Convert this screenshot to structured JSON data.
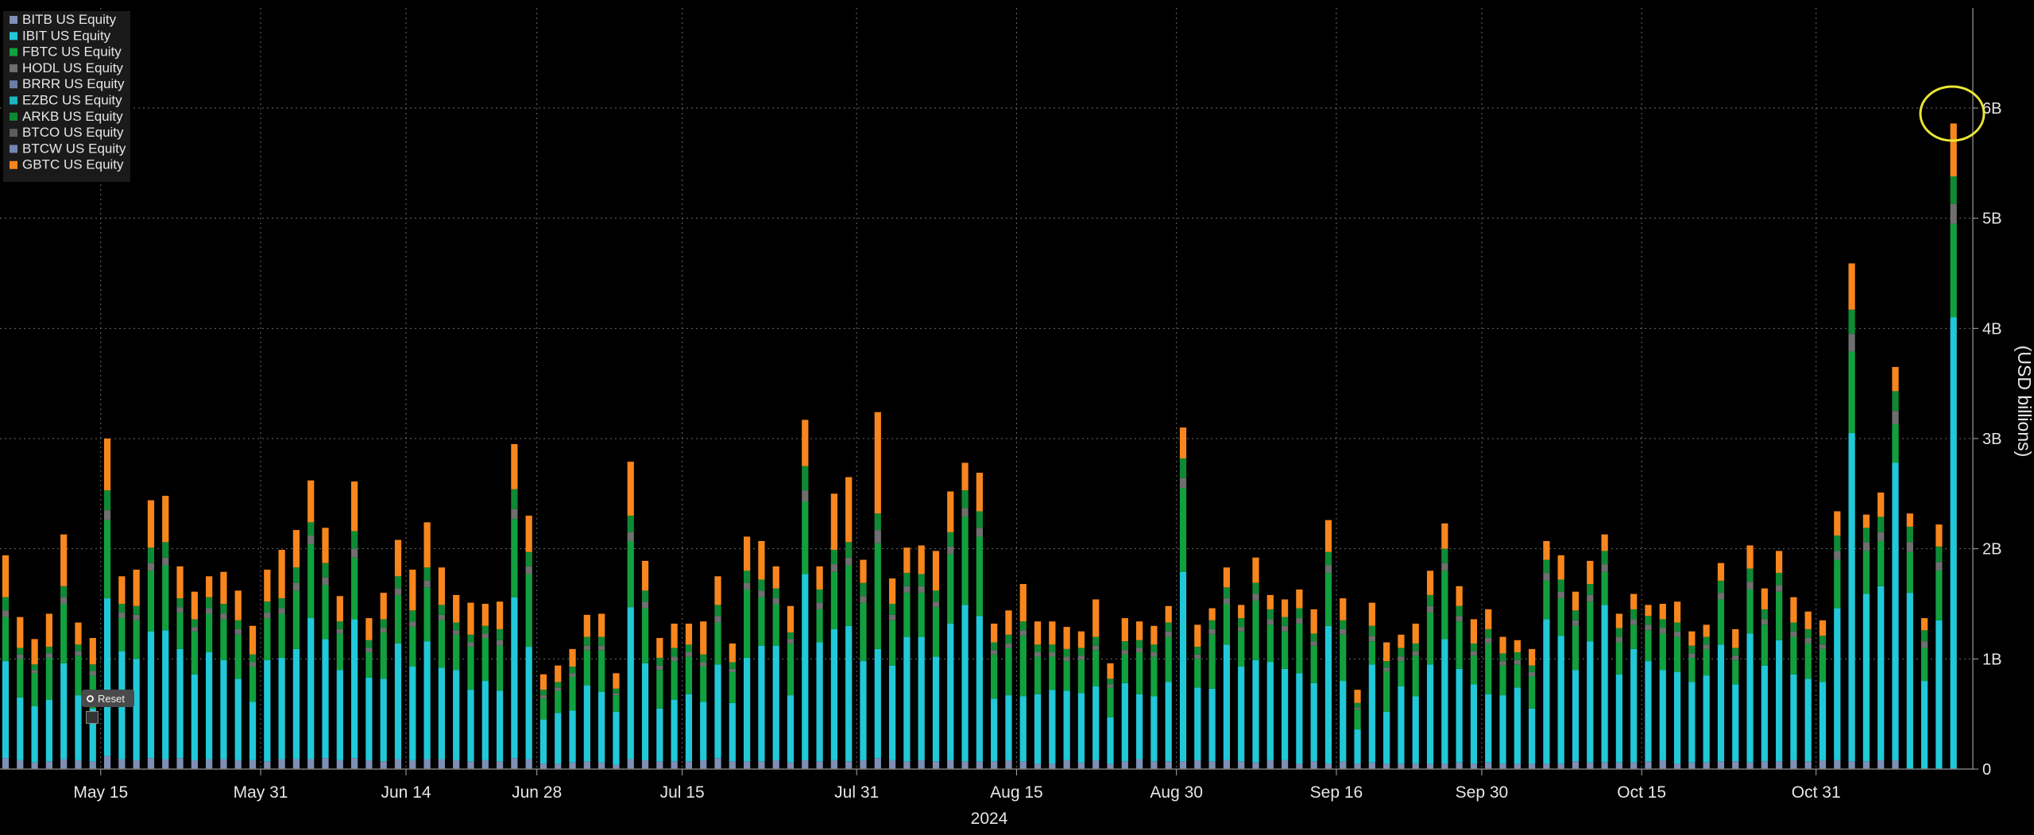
{
  "chart_data": {
    "type": "bar",
    "stacked": true,
    "ylabel": "(USD billions)",
    "xlabel_year": "2024",
    "ylim": [
      0,
      7
    ],
    "y_ticks": [
      {
        "value": 0,
        "label": "0"
      },
      {
        "value": 1,
        "label": "1B"
      },
      {
        "value": 2,
        "label": "2B"
      },
      {
        "value": 3,
        "label": "3B"
      },
      {
        "value": 4,
        "label": "4B"
      },
      {
        "value": 5,
        "label": "5B"
      },
      {
        "value": 6,
        "label": "6B"
      }
    ],
    "x_ticks": [
      {
        "index": 6,
        "label": "May 15"
      },
      {
        "index": 17,
        "label": "May 31"
      },
      {
        "index": 27,
        "label": "Jun 14"
      },
      {
        "index": 36,
        "label": "Jun 28"
      },
      {
        "index": 46,
        "label": "Jul 15"
      },
      {
        "index": 58,
        "label": "Jul 31"
      },
      {
        "index": 69,
        "label": "Aug 15"
      },
      {
        "index": 80,
        "label": "Aug 30"
      },
      {
        "index": 91,
        "label": "Sep 16"
      },
      {
        "index": 101,
        "label": "Sep 30"
      },
      {
        "index": 112,
        "label": "Oct 15"
      },
      {
        "index": 124,
        "label": "Oct 31"
      }
    ],
    "legend_position": "top-left",
    "series_order_bottom_to_top": [
      "BITB US Equity",
      "IBIT US Equity",
      "FBTC US Equity",
      "HODL US Equity",
      "BRRR US Equity",
      "EZBC US Equity",
      "ARKB US Equity",
      "BTCO US Equity",
      "BTCW US Equity",
      "GBTC US Equity"
    ],
    "legend": [
      {
        "name": "BITB US Equity",
        "color": "#7f8fb5"
      },
      {
        "name": "IBIT US Equity",
        "color": "#21c8d8"
      },
      {
        "name": "FBTC US Equity",
        "color": "#12a03e"
      },
      {
        "name": "HODL US Equity",
        "color": "#6f6f6f"
      },
      {
        "name": "BRRR US Equity",
        "color": "#6a7fa8"
      },
      {
        "name": "EZBC US Equity",
        "color": "#1bb5c4"
      },
      {
        "name": "ARKB US Equity",
        "color": "#0f8a34"
      },
      {
        "name": "BTCO US Equity",
        "color": "#5c5c5c"
      },
      {
        "name": "BTCW US Equity",
        "color": "#7088b0"
      },
      {
        "name": "GBTC US Equity",
        "color": "#f7861e"
      }
    ],
    "series_values": {
      "BITB": [
        0.1,
        0.08,
        0.06,
        0.07,
        0.09,
        0.08,
        0.07,
        0.12,
        0.09,
        0.08,
        0.1,
        0.09,
        0.1,
        0.08,
        0.09,
        0.09,
        0.08,
        0.08,
        0.07,
        0.09,
        0.09,
        0.09,
        0.1,
        0.08,
        0.1,
        0.08,
        0.07,
        0.09,
        0.08,
        0.09,
        0.09,
        0.08,
        0.07,
        0.08,
        0.07,
        0.1,
        0.09,
        0.05,
        0.05,
        0.06,
        0.07,
        0.06,
        0.04,
        0.09,
        0.08,
        0.07,
        0.07,
        0.07,
        0.08,
        0.1,
        0.07,
        0.07,
        0.07,
        0.08,
        0.06,
        0.08,
        0.07,
        0.08,
        0.07,
        0.08,
        0.1,
        0.08,
        0.07,
        0.08,
        0.07,
        0.08,
        0.07,
        0.07,
        0.07,
        0.08,
        0.07,
        0.05,
        0.05,
        0.08,
        0.06,
        0.08,
        0.05,
        0.07,
        0.09,
        0.07,
        0.07,
        0.07,
        0.08,
        0.07,
        0.08,
        0.07,
        0.06,
        0.08,
        0.08,
        0.05,
        0.07,
        0.05,
        0.07,
        0.05,
        0.06,
        0.05,
        0.05,
        0.05,
        0.05,
        0.05,
        0.06,
        0.05,
        0.06,
        0.05,
        0.05,
        0.05,
        0.05,
        0.05,
        0.07,
        0.06,
        0.06,
        0.06,
        0.06,
        0.07,
        0.08,
        0.05,
        0.06,
        0.06,
        0.07,
        0.07,
        0.06,
        0.07,
        0.07,
        0.08,
        0.07,
        0.08,
        0.08,
        0.07,
        0.07,
        0.08,
        0.08
      ],
      "IBIT": [
        0.88,
        0.57,
        0.51,
        0.56,
        0.87,
        0.59,
        0.48,
        1.43,
        0.98,
        0.92,
        1.15,
        1.17,
        0.99,
        0.78,
        0.97,
        0.9,
        0.74,
        0.53,
        0.92,
        0.92,
        1.0,
        1.28,
        1.08,
        0.82,
        1.26,
        0.75,
        0.75,
        1.05,
        0.85,
        1.07,
        0.83,
        0.82,
        0.65,
        0.72,
        0.64,
        1.46,
        1.02,
        0.4,
        0.46,
        0.47,
        0.69,
        0.64,
        0.48,
        1.38,
        0.88,
        0.48,
        0.56,
        0.61,
        0.53,
        0.85,
        0.53,
        0.94,
        1.05,
        1.04,
        0.61,
        1.69,
        1.08,
        1.19,
        1.23,
        0.9,
        0.99,
        0.86,
        1.13,
        1.12,
        0.95,
        1.24,
        1.42,
        1.32,
        0.57,
        0.59,
        0.59,
        0.63,
        0.67,
        0.63,
        0.63,
        0.67,
        0.42,
        0.71,
        0.59,
        0.59,
        0.72,
        1.72,
        0.66,
        0.66,
        1.05,
        0.86,
        0.93,
        0.89,
        0.83,
        0.82,
        0.71,
        1.25,
        0.73,
        0.31,
        0.89,
        0.47,
        0.7,
        0.61,
        0.9,
        1.13,
        0.85,
        0.72,
        0.62,
        0.62,
        0.69,
        0.5,
        1.31,
        1.16,
        0.83,
        1.1,
        1.43,
        0.8,
        1.03,
        0.91,
        0.82,
        0.83,
        0.73,
        0.79,
        1.06,
        0.7,
        1.17,
        0.87,
        1.1,
        0.78,
        0.75,
        0.71,
        1.38,
        2.98,
        1.52,
        1.58,
        2.7,
        1.6,
        0.8,
        1.35,
        4.1
      ],
      "FBTC": [
        0.4,
        0.35,
        0.3,
        0.38,
        0.54,
        0.36,
        0.3,
        0.71,
        0.3,
        0.35,
        0.55,
        0.59,
        0.33,
        0.39,
        0.35,
        0.37,
        0.4,
        0.32,
        0.38,
        0.4,
        0.53,
        0.67,
        0.49,
        0.33,
        0.56,
        0.23,
        0.42,
        0.44,
        0.36,
        0.49,
        0.43,
        0.32,
        0.39,
        0.39,
        0.41,
        0.71,
        0.66,
        0.19,
        0.2,
        0.31,
        0.32,
        0.38,
        0.15,
        0.6,
        0.5,
        0.35,
        0.35,
        0.34,
        0.32,
        0.38,
        0.28,
        0.62,
        0.44,
        0.38,
        0.47,
        0.66,
        0.3,
        0.52,
        0.55,
        0.53,
        0.96,
        0.41,
        0.4,
        0.4,
        0.45,
        0.63,
        0.8,
        0.72,
        0.4,
        0.43,
        0.55,
        0.34,
        0.3,
        0.27,
        0.3,
        0.33,
        0.27,
        0.26,
        0.38,
        0.36,
        0.41,
        0.76,
        0.26,
        0.49,
        0.37,
        0.32,
        0.54,
        0.34,
        0.34,
        0.45,
        0.34,
        0.48,
        0.42,
        0.18,
        0.21,
        0.37,
        0.23,
        0.37,
        0.47,
        0.62,
        0.43,
        0.26,
        0.46,
        0.27,
        0.21,
        0.29,
        0.35,
        0.34,
        0.4,
        0.36,
        0.3,
        0.29,
        0.22,
        0.28,
        0.33,
        0.32,
        0.22,
        0.24,
        0.41,
        0.22,
        0.4,
        0.37,
        0.44,
        0.34,
        0.32,
        0.3,
        0.44,
        0.74,
        0.39,
        0.41,
        0.35,
        0.37,
        0.3,
        0.45,
        0.85
      ],
      "ARKB": [
        0.12,
        0.06,
        0.05,
        0.06,
        0.1,
        0.06,
        0.06,
        0.18,
        0.08,
        0.08,
        0.14,
        0.14,
        0.08,
        0.07,
        0.1,
        0.09,
        0.08,
        0.07,
        0.1,
        0.09,
        0.14,
        0.12,
        0.13,
        0.07,
        0.16,
        0.07,
        0.08,
        0.11,
        0.1,
        0.12,
        0.09,
        0.07,
        0.07,
        0.07,
        0.1,
        0.18,
        0.13,
        0.05,
        0.05,
        0.06,
        0.08,
        0.08,
        0.04,
        0.15,
        0.1,
        0.07,
        0.08,
        0.07,
        0.07,
        0.1,
        0.06,
        0.11,
        0.1,
        0.09,
        0.06,
        0.22,
        0.12,
        0.13,
        0.14,
        0.12,
        0.15,
        0.1,
        0.12,
        0.11,
        0.1,
        0.13,
        0.16,
        0.15,
        0.07,
        0.08,
        0.08,
        0.07,
        0.07,
        0.07,
        0.07,
        0.08,
        0.05,
        0.08,
        0.07,
        0.07,
        0.08,
        0.18,
        0.07,
        0.08,
        0.1,
        0.08,
        0.1,
        0.09,
        0.08,
        0.09,
        0.07,
        0.12,
        0.08,
        0.04,
        0.09,
        0.06,
        0.08,
        0.07,
        0.1,
        0.13,
        0.09,
        0.07,
        0.08,
        0.07,
        0.07,
        0.06,
        0.12,
        0.11,
        0.09,
        0.1,
        0.12,
        0.08,
        0.09,
        0.08,
        0.08,
        0.08,
        0.07,
        0.07,
        0.11,
        0.07,
        0.12,
        0.09,
        0.11,
        0.08,
        0.08,
        0.08,
        0.14,
        0.22,
        0.13,
        0.14,
        0.18,
        0.14,
        0.1,
        0.14,
        0.25
      ],
      "Other": [
        0.06,
        0.04,
        0.03,
        0.04,
        0.06,
        0.04,
        0.04,
        0.09,
        0.05,
        0.05,
        0.07,
        0.07,
        0.05,
        0.04,
        0.05,
        0.05,
        0.05,
        0.04,
        0.05,
        0.05,
        0.07,
        0.08,
        0.07,
        0.04,
        0.08,
        0.04,
        0.04,
        0.06,
        0.05,
        0.06,
        0.05,
        0.04,
        0.04,
        0.04,
        0.05,
        0.09,
        0.07,
        0.03,
        0.03,
        0.03,
        0.04,
        0.04,
        0.02,
        0.08,
        0.06,
        0.04,
        0.04,
        0.04,
        0.04,
        0.06,
        0.03,
        0.06,
        0.06,
        0.05,
        0.04,
        0.1,
        0.06,
        0.07,
        0.07,
        0.06,
        0.12,
        0.05,
        0.06,
        0.06,
        0.05,
        0.07,
        0.08,
        0.08,
        0.04,
        0.04,
        0.05,
        0.04,
        0.04,
        0.04,
        0.04,
        0.04,
        0.03,
        0.04,
        0.04,
        0.04,
        0.05,
        0.09,
        0.04,
        0.05,
        0.05,
        0.04,
        0.06,
        0.05,
        0.05,
        0.05,
        0.04,
        0.07,
        0.05,
        0.02,
        0.05,
        0.03,
        0.04,
        0.04,
        0.06,
        0.07,
        0.05,
        0.04,
        0.05,
        0.04,
        0.04,
        0.04,
        0.07,
        0.06,
        0.05,
        0.06,
        0.07,
        0.05,
        0.05,
        0.05,
        0.05,
        0.05,
        0.04,
        0.04,
        0.06,
        0.04,
        0.07,
        0.05,
        0.06,
        0.05,
        0.05,
        0.04,
        0.08,
        0.16,
        0.08,
        0.08,
        0.12,
        0.09,
        0.06,
        0.08,
        0.18
      ],
      "GBTC": [
        0.38,
        0.28,
        0.23,
        0.3,
        0.47,
        0.2,
        0.24,
        0.47,
        0.25,
        0.33,
        0.43,
        0.42,
        0.29,
        0.25,
        0.19,
        0.29,
        0.27,
        0.26,
        0.29,
        0.44,
        0.34,
        0.38,
        0.32,
        0.23,
        0.45,
        0.2,
        0.24,
        0.33,
        0.37,
        0.41,
        0.34,
        0.25,
        0.29,
        0.2,
        0.25,
        0.41,
        0.33,
        0.14,
        0.15,
        0.16,
        0.2,
        0.21,
        0.14,
        0.49,
        0.27,
        0.18,
        0.22,
        0.19,
        0.3,
        0.26,
        0.17,
        0.31,
        0.35,
        0.2,
        0.24,
        0.42,
        0.21,
        0.51,
        0.59,
        0.21,
        0.92,
        0.23,
        0.23,
        0.26,
        0.36,
        0.37,
        0.25,
        0.35,
        0.17,
        0.22,
        0.34,
        0.21,
        0.21,
        0.2,
        0.15,
        0.34,
        0.14,
        0.21,
        0.17,
        0.17,
        0.15,
        0.28,
        0.2,
        0.11,
        0.18,
        0.12,
        0.23,
        0.13,
        0.16,
        0.17,
        0.22,
        0.29,
        0.2,
        0.12,
        0.21,
        0.17,
        0.12,
        0.18,
        0.22,
        0.23,
        0.18,
        0.22,
        0.18,
        0.15,
        0.11,
        0.15,
        0.17,
        0.22,
        0.17,
        0.21,
        0.15,
        0.13,
        0.14,
        0.1,
        0.14,
        0.19,
        0.13,
        0.11,
        0.16,
        0.17,
        0.21,
        0.19,
        0.2,
        0.23,
        0.16,
        0.14,
        0.22,
        0.42,
        0.12,
        0.22,
        0.22,
        0.12,
        0.11,
        0.2,
        0.48
      ]
    },
    "annotation": "yellow-circle-on-last-bar"
  },
  "controls": {
    "reset_label": "Reset"
  }
}
